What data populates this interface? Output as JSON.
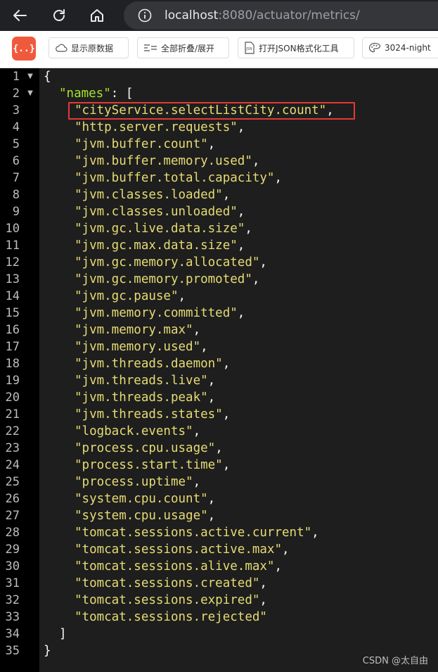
{
  "browser": {
    "url_host": "localhost",
    "url_rest": ":8080/actuator/metrics/"
  },
  "toolbar": {
    "logo_label": "{..}",
    "buttons": [
      {
        "label": "显示原数据",
        "icon": "cloud-icon"
      },
      {
        "label": "全部折叠/展开",
        "icon": "collapse-icon"
      },
      {
        "label": "打开JSON格式化工具",
        "icon": "json-file-icon"
      },
      {
        "label": "3024-night",
        "icon": "palette-icon"
      }
    ]
  },
  "code": {
    "open_brace": "{",
    "key": "\"names\"",
    "colon": ": ",
    "open_bracket": "[",
    "close_bracket": "]",
    "close_brace": "}",
    "names": [
      "cityService.selectListCity.count",
      "http.server.requests",
      "jvm.buffer.count",
      "jvm.buffer.memory.used",
      "jvm.buffer.total.capacity",
      "jvm.classes.loaded",
      "jvm.classes.unloaded",
      "jvm.gc.live.data.size",
      "jvm.gc.max.data.size",
      "jvm.gc.memory.allocated",
      "jvm.gc.memory.promoted",
      "jvm.gc.pause",
      "jvm.memory.committed",
      "jvm.memory.max",
      "jvm.memory.used",
      "jvm.threads.daemon",
      "jvm.threads.live",
      "jvm.threads.peak",
      "jvm.threads.states",
      "logback.events",
      "process.cpu.usage",
      "process.start.time",
      "process.uptime",
      "system.cpu.count",
      "system.cpu.usage",
      "tomcat.sessions.active.current",
      "tomcat.sessions.active.max",
      "tomcat.sessions.alive.max",
      "tomcat.sessions.created",
      "tomcat.sessions.expired",
      "tomcat.sessions.rejected"
    ],
    "line_count": 35,
    "highlighted_index": 0
  },
  "watermark": "CSDN @太自由",
  "colors": {
    "string": "#e6db74",
    "key": "#a6e22e",
    "highlight": "#e53935",
    "logo": "#f05a3c"
  }
}
